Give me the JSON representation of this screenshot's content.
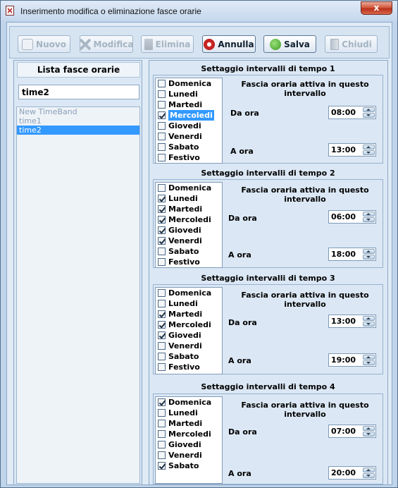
{
  "window": {
    "title": "Inserimento modifica o eliminazione fasce orarie",
    "close_glyph": "x"
  },
  "toolbar": {
    "new_label": "Nuovo",
    "edit_label": "Modifica",
    "delete_label": "Elimina",
    "cancel_label": "Annulla",
    "save_label": "Salva",
    "close_label": "Chiudi"
  },
  "left": {
    "title": "Lista fasce orarie",
    "filter_value": "time2",
    "items": [
      "New TimeBand",
      "time1",
      "time2"
    ]
  },
  "sections": [
    {
      "title": "Settaggio intervalli di tempo 1",
      "active_label": "Fascia oraria attiva in questo intervallo",
      "from_label": "Da ora",
      "from_value": "08:00",
      "to_label": "A ora",
      "to_value": "13:00",
      "days": [
        {
          "label": "Domenica",
          "checked": false
        },
        {
          "label": "Lunedi",
          "checked": false
        },
        {
          "label": "Martedi",
          "checked": false
        },
        {
          "label": "Mercoledi",
          "checked": true,
          "selected": true
        },
        {
          "label": "Giovedi",
          "checked": false
        },
        {
          "label": "Venerdi",
          "checked": false
        },
        {
          "label": "Sabato",
          "checked": false
        },
        {
          "label": "Festivo",
          "checked": false
        }
      ]
    },
    {
      "title": "Settaggio intervalli di tempo 2",
      "active_label": "Fascia oraria attiva in questo intervallo",
      "from_label": "Da ora",
      "from_value": "06:00",
      "to_label": "A ora",
      "to_value": "18:00",
      "days": [
        {
          "label": "Domenica",
          "checked": false
        },
        {
          "label": "Lunedi",
          "checked": true
        },
        {
          "label": "Martedi",
          "checked": true
        },
        {
          "label": "Mercoledi",
          "checked": true
        },
        {
          "label": "Giovedi",
          "checked": true
        },
        {
          "label": "Venerdi",
          "checked": true
        },
        {
          "label": "Sabato",
          "checked": false
        },
        {
          "label": "Festivo",
          "checked": false
        }
      ]
    },
    {
      "title": "Settaggio intervalli di tempo 3",
      "active_label": "Fascia oraria attiva in questo intervallo",
      "from_label": "Da ora",
      "from_value": "13:00",
      "to_label": "A ora",
      "to_value": "19:00",
      "days": [
        {
          "label": "Domenica",
          "checked": false
        },
        {
          "label": "Lunedi",
          "checked": false
        },
        {
          "label": "Martedi",
          "checked": true
        },
        {
          "label": "Mercoledi",
          "checked": true
        },
        {
          "label": "Giovedi",
          "checked": true
        },
        {
          "label": "Venerdi",
          "checked": false
        },
        {
          "label": "Sabato",
          "checked": false
        },
        {
          "label": "Festivo",
          "checked": false
        }
      ]
    },
    {
      "title": "Settaggio intervalli di tempo 4",
      "active_label": "Fascia oraria attiva in questo intervallo",
      "from_label": "Da ora",
      "from_value": "07:00",
      "to_label": "A ora",
      "to_value": "20:00",
      "days": [
        {
          "label": "Domenica",
          "checked": true
        },
        {
          "label": "Lunedi",
          "checked": false
        },
        {
          "label": "Martedi",
          "checked": false
        },
        {
          "label": "Mercoledi",
          "checked": false
        },
        {
          "label": "Giovedi",
          "checked": false
        },
        {
          "label": "Venerdi",
          "checked": false
        },
        {
          "label": "Sabato",
          "checked": true
        }
      ]
    }
  ]
}
